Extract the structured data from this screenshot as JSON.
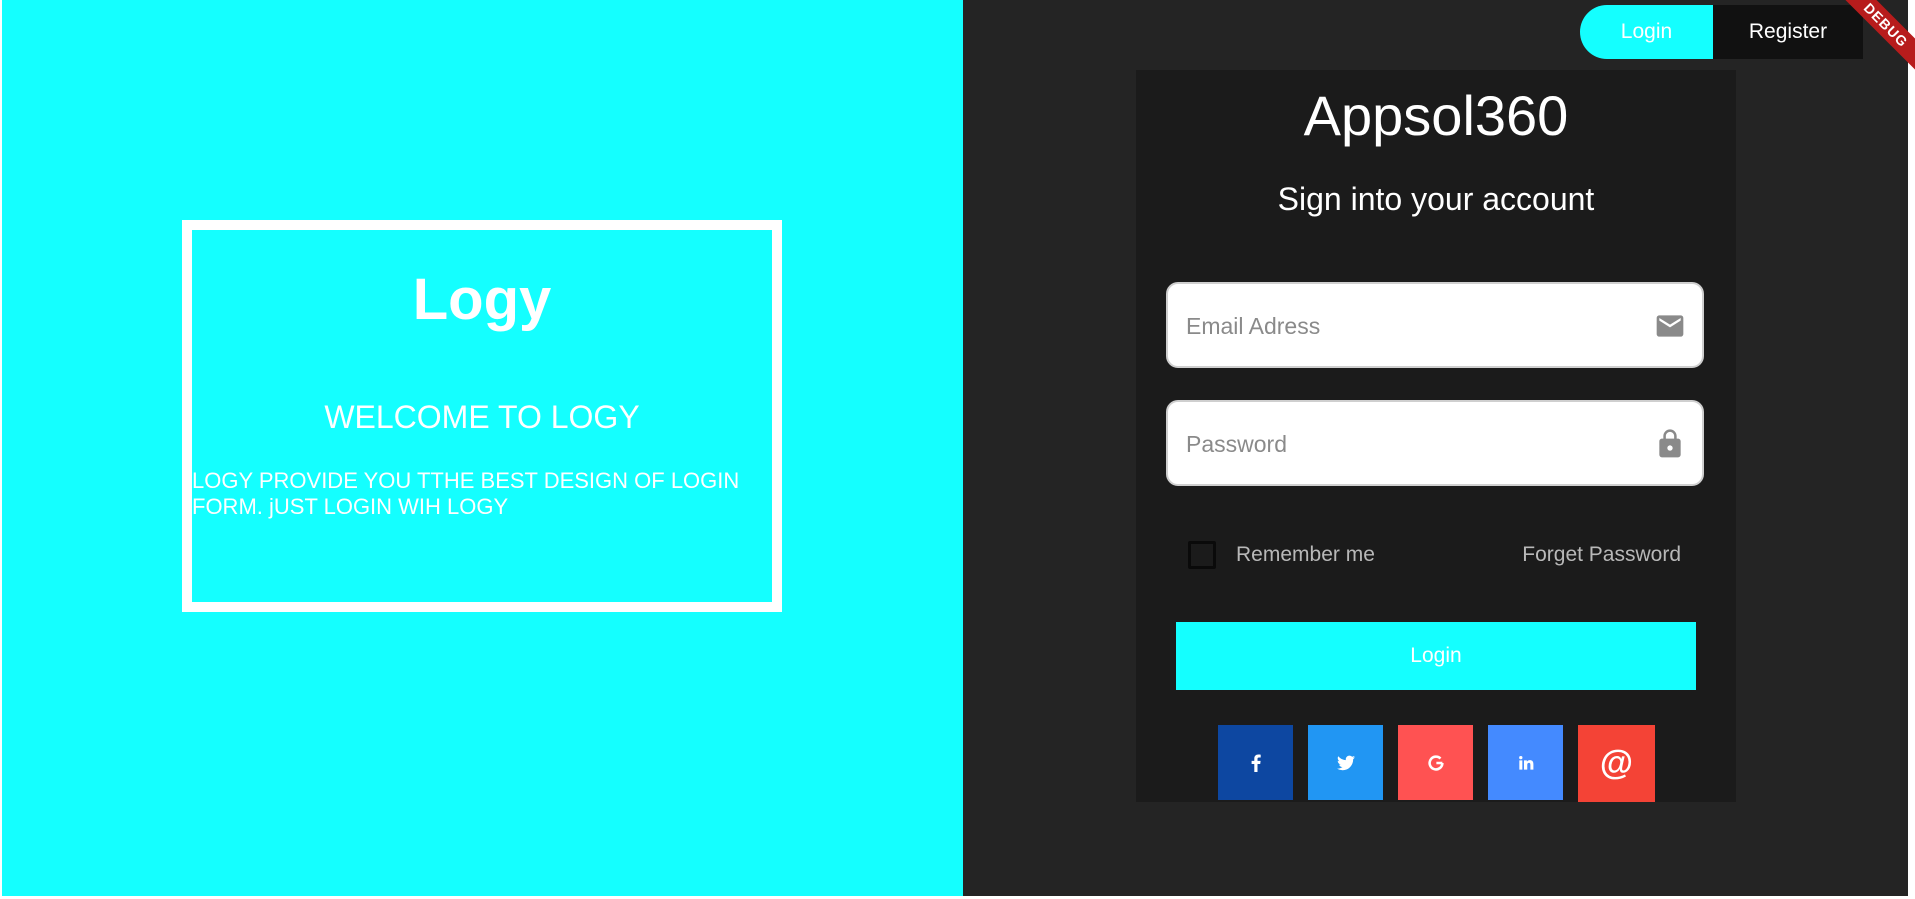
{
  "left_panel": {
    "brand": "Logy",
    "welcome_title": "WELCOME TO LOGY",
    "welcome_desc": "LOGY PROVIDE YOU TTHE BEST DESIGN OF LOGIN FORM. jUST LOGIN WIH LOGY"
  },
  "card": {
    "title": "Appsol360",
    "subtitle": "Sign into your account",
    "email_placeholder": "Email Adress",
    "password_placeholder": "Password",
    "remember_label": "Remember me",
    "forget_label": "Forget Password",
    "login_button": "Login"
  },
  "social": {
    "items": [
      {
        "name": "facebook",
        "icon": "facebook-icon",
        "color": "#0d47a1"
      },
      {
        "name": "twitter",
        "icon": "twitter-icon",
        "color": "#2196f3"
      },
      {
        "name": "google",
        "icon": "google-icon",
        "color": "#ff5252"
      },
      {
        "name": "linkedin",
        "icon": "linkedin-icon",
        "color": "#448aff"
      },
      {
        "name": "email",
        "icon": "at-icon",
        "label": "@",
        "color": "#f44336"
      }
    ]
  },
  "nav": {
    "login": "Login",
    "register": "Register"
  },
  "debug_banner": "DEBUG",
  "colors": {
    "accent": "#14ffff",
    "dark_panel": "#242424",
    "card": "#1b1b1b"
  }
}
